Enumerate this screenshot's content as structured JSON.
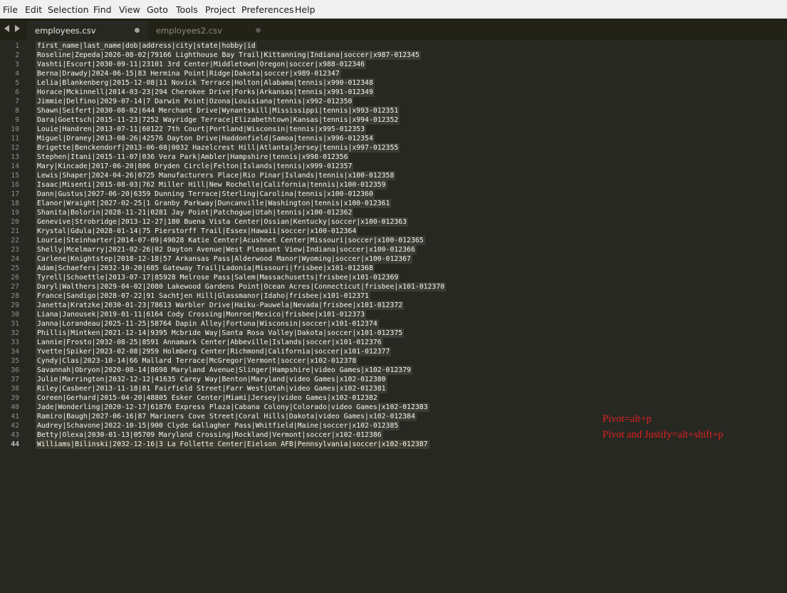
{
  "menu": [
    "File",
    "Edit",
    "Selection",
    "Find",
    "View",
    "Goto",
    "Tools",
    "Project",
    "Preferences",
    "Help"
  ],
  "tabs": [
    {
      "label": "employees.csv",
      "active": true
    },
    {
      "label": "employees2.csv",
      "active": false
    }
  ],
  "lines": [
    "first_name|last_name|dob|address|city|state|hobby|id",
    "Roseline|Zepeda|2026-08-02|79166 Lighthouse Bay Trail|Kittanning|Indiana|soccer|x987-012345",
    "Vashti|Escort|2030-09-11|23101 3rd Center|Middletown|Oregon|soccer|x988-012346",
    "Berna|Drawdy|2024-06-15|83 Hermina Point|Ridge|Dakota|soccer|x989-012347",
    "Lelia|Blankenberg|2015-12-08|11 Novick Terrace|Holton|Alabama|tennis|x990-012348",
    "Horace|Mckinnell|2014-03-23|294 Cherokee Drive|Forks|Arkansas|tennis|x991-012349",
    "Jimmie|Delfino|2029-07-14|7 Darwin Point|Ozona|Louisiana|tennis|x992-012350",
    "Shawn|Seifert|2030-08-02|644 Merchant Drive|Wynantskill|Mississippi|tennis|x993-012351",
    "Dara|Goettsch|2015-11-23|7252 Wayridge Terrace|Elizabethtown|Kansas|tennis|x994-012352",
    "Louie|Handren|2013-07-11|60122 7th Court|Portland|Wisconsin|tennis|x995-012353",
    "Miguel|Draney|2013-08-26|42576 Dayton Drive|Haddonfield|Samoa|tennis|x996-012354",
    "Brigette|Benckendorf|2013-06-08|0032 Hazelcrest Hill|Atlanta|Jersey|tennis|x997-012355",
    "Stephen|Itani|2015-11-07|036 Vera Park|Ambler|Hampshire|tennis|x998-012356",
    "Mary|Kincade|2017-06-20|806 Dryden Circle|Felton|Islands|tennis|x999-012357",
    "Lewis|Shaper|2024-04-26|0725 Manufacturers Place|Rio Pinar|Islands|tennis|x100-012358",
    "Isaac|Misenti|2015-08-03|762 Miller Hill|New Rochelle|California|tennis|x100-012359",
    "Dann|Gustus|2027-06-20|6359 Dunning Terrace|Sterling|Carolina|tennis|x100-012360",
    "Elanor|Wraight|2027-02-25|1 Granby Parkway|Duncanville|Washington|tennis|x100-012361",
    "Shanita|Bolorin|2028-11-21|0281 Jay Point|Patchogue|Utah|tennis|x100-012362",
    "Genevive|Strobridge|2013-12-27|180 Buena Vista Center|Ossian|Kentucky|soccer|x100-012363",
    "Krystal|Gdula|2028-01-14|75 Pierstorff Trail|Essex|Hawaii|soccer|x100-012364",
    "Lourie|Steinharter|2014-07-09|49028 Katie Center|Acushnet Center|Missouri|soccer|x100-012365",
    "Shelly|Mcelmarry|2021-02-26|02 Dayton Avenue|West Pleasant View|Indiana|soccer|x100-012366",
    "Carlene|Knightstep|2018-12-18|57 Arkansas Pass|Alderwood Manor|Wyoming|soccer|x100-012367",
    "Adam|Schaefers|2032-10-20|685 Gateway Trail|Ladonia|Missouri|frisbee|x101-012368",
    "Tyrell|Schoettle|2013-07-17|85928 Melrose Pass|Salem|Massachusetts|frisbee|x101-012369",
    "Daryl|Walthers|2029-04-02|2080 Lakewood Gardens Point|Ocean Acres|Connecticut|frisbee|x101-012370",
    "France|Sandigo|2028-07-22|91 Sachtjen Hill|Glassmanor|Idaho|frisbee|x101-012371",
    "Janetta|Kratzke|2030-01-23|78613 Warbler Drive|Haiku-Pauwela|Nevada|frisbee|x101-012372",
    "Liana|Janousek|2019-01-11|6164 Cody Crossing|Monroe|Mexico|frisbee|x101-012373",
    "Janna|Lorandeau|2025-11-25|58764 Dapin Alley|Fortuna|Wisconsin|soccer|x101-012374",
    "Phillis|Mintken|2021-12-14|9395 Mcbride Way|Santa Rosa Valley|Dakota|soccer|x101-012375",
    "Lannie|Frosto|2032-08-25|8591 Annamark Center|Abbeville|Islands|soccer|x101-012376",
    "Yvette|Spiker|2023-02-08|2959 Holmberg Center|Richmond|California|soccer|x101-012377",
    "Cyndy|Clas|2023-10-14|66 Mallard Terrace|McGregor|Vermont|soccer|x102-012378",
    "Savannah|Obryon|2020-08-14|8698 Maryland Avenue|Slinger|Hampshire|video Games|x102-012379",
    "Julie|Marrington|2032-12-12|41635 Carey Way|Benton|Maryland|video Games|x102-012380",
    "Riley|Casbeer|2013-11-18|81 Fairfield Street|Farr West|Utah|video Games|x102-012381",
    "Coreen|Gerhard|2015-04-20|48805 Esker Center|Miami|Jersey|video Games|x102-012382",
    "Jade|Wonderling|2020-12-17|61876 Express Plaza|Cabana Colony|Colorado|video Games|x102-012383",
    "Ramiro|Baugh|2027-06-16|87 Mariners Cove Street|Coral Hills|Dakota|video Games|x102-012384",
    "Audrey|Schavone|2022-10-15|900 Clyde Gallagher Pass|Whitfield|Maine|soccer|x102-012385",
    "Betty|Olexa|2030-01-13|05709 Maryland Crossing|Rockland|Vermont|soccer|x102-012386",
    "Williams|Bilinski|2032-12-16|3 La Follette Center|Eielson AFB|Pennsylvania|soccer|x102-012387"
  ],
  "notes": {
    "pivot": "Pivot=alt+p",
    "pivot_justify": "Pivot and Justify=alt+shift+p"
  },
  "colors": {
    "note": "#e02020",
    "editor_bg": "#272822",
    "text": "#f8f8f2"
  }
}
